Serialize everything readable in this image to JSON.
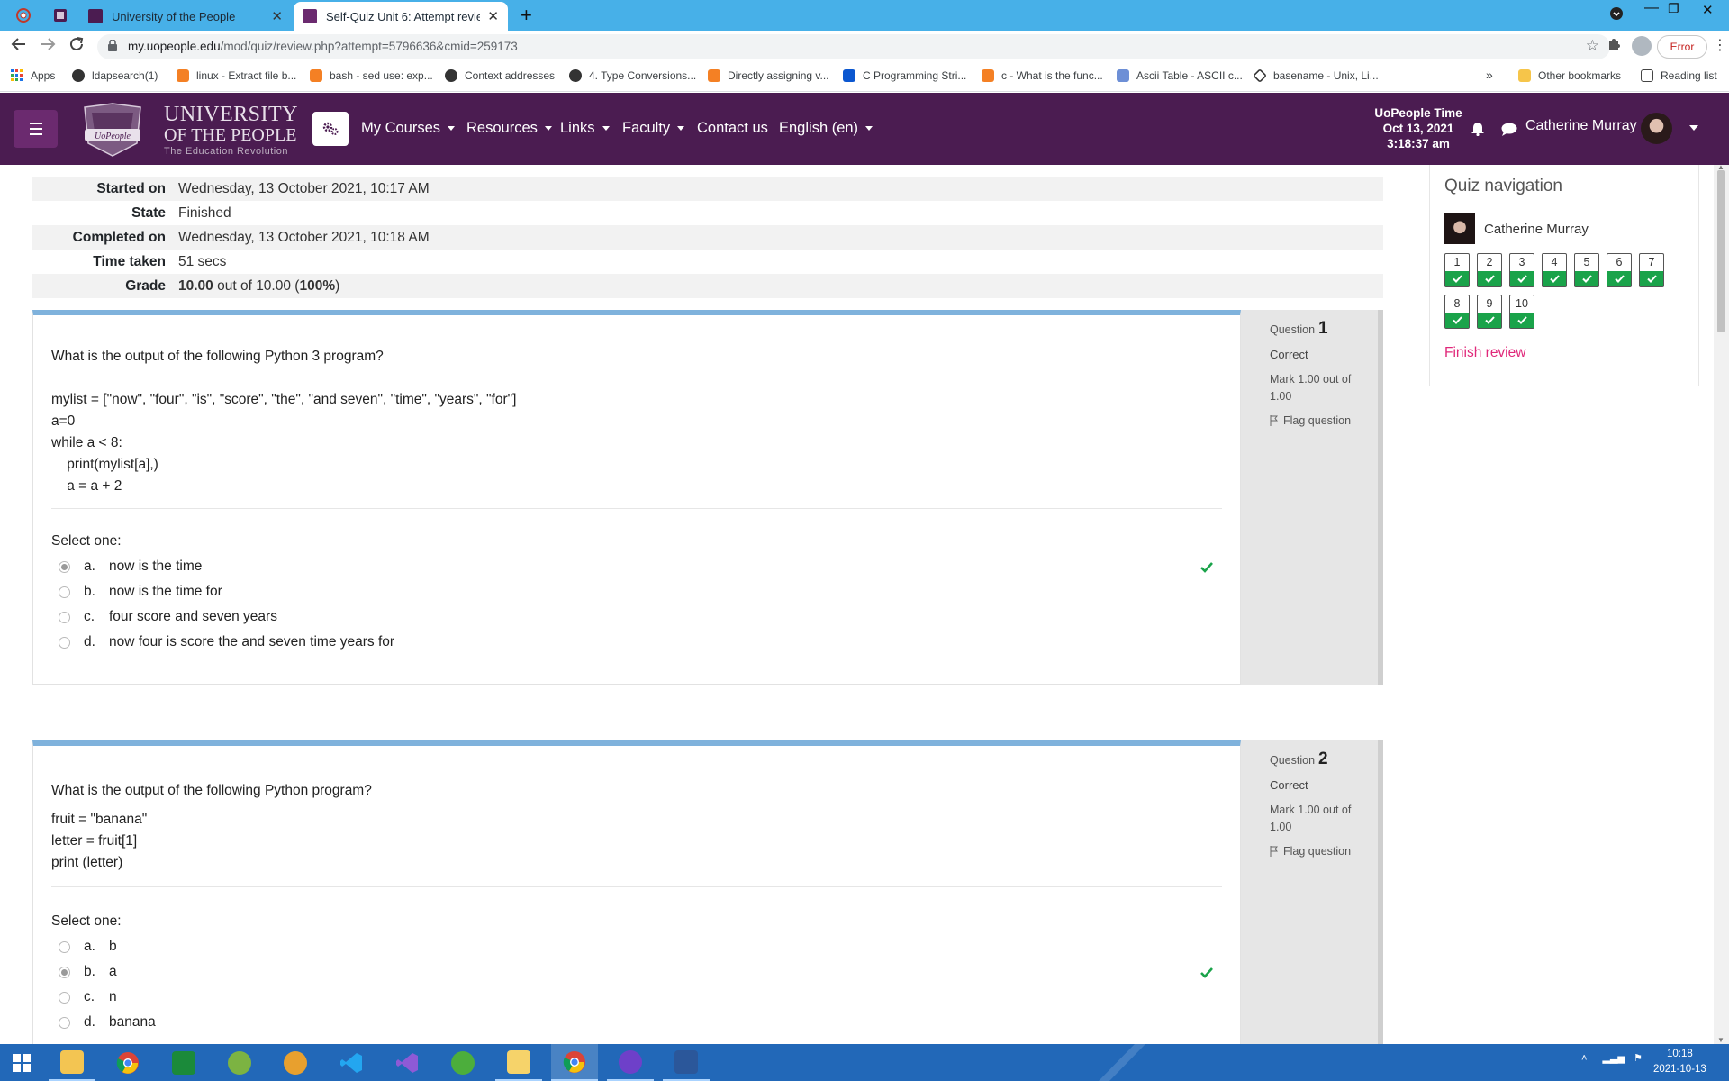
{
  "browser": {
    "tabs": [
      {
        "title": "University of the People",
        "active": false
      },
      {
        "title": "Self-Quiz Unit 6: Attempt review",
        "active": true
      }
    ],
    "url_host": "my.uopeople.edu",
    "url_path": "/mod/quiz/review.php?attempt=5796636&cmid=259173",
    "error_label": "Error",
    "bookmarks": [
      "Apps",
      "ldapsearch(1)",
      "linux - Extract file b...",
      "bash - sed use: exp...",
      "Context addresses",
      "4. Type Conversions...",
      "Directly assigning v...",
      "C Programming Stri...",
      "c - What is the func...",
      "Ascii Table - ASCII c...",
      "basename - Unix, Li...",
      "»",
      "Other bookmarks",
      "Reading list"
    ]
  },
  "site": {
    "logo_line1": "UNIVERSITY",
    "logo_line2": "OF THE PEOPLE",
    "logo_tagline": "The Education Revolution",
    "crest_text": "UoPeople",
    "nav": [
      "My Courses",
      "Resources",
      "Links",
      "Faculty",
      "Contact us",
      "English (en)"
    ],
    "time_label": "UoPeople Time",
    "time_date": "Oct 13, 2021",
    "time_clock": "3:18:37 am",
    "user_name": "Catherine Murray"
  },
  "summary": [
    {
      "label": "Started on",
      "value": "Wednesday, 13 October 2021, 10:17 AM"
    },
    {
      "label": "State",
      "value": "Finished"
    },
    {
      "label": "Completed on",
      "value": "Wednesday, 13 October 2021, 10:18 AM"
    },
    {
      "label": "Time taken",
      "value": "51 secs"
    }
  ],
  "grade": {
    "label": "Grade",
    "score": "10.00",
    "mid": " out of 10.00 (",
    "pct": "100%",
    "end": ")"
  },
  "questions": [
    {
      "label": "Question",
      "number": "1",
      "state": "Correct",
      "mark": "Mark 1.00 out of 1.00",
      "flag": "Flag question",
      "prompt": "What is the output of the following Python 3 program?",
      "code": "mylist = [\"now\", \"four\", \"is\", \"score\", \"the\", \"and seven\", \"time\", \"years\", \"for\"]\na=0\nwhile a < 8:\n    print(mylist[a],)\n    a = a + 2",
      "select": "Select one:",
      "options": [
        {
          "letter": "a.",
          "text": "now is the time",
          "selected": true
        },
        {
          "letter": "b.",
          "text": "now is the time for",
          "selected": false
        },
        {
          "letter": "c.",
          "text": "four score and seven years",
          "selected": false
        },
        {
          "letter": "d.",
          "text": "now four is score the and seven time years for",
          "selected": false
        }
      ]
    },
    {
      "label": "Question",
      "number": "2",
      "state": "Correct",
      "mark": "Mark 1.00 out of 1.00",
      "flag": "Flag question",
      "prompt": "What is the output of the following Python program?",
      "code": "fruit = \"banana\"\nletter = fruit[1]\nprint (letter)",
      "select": "Select one:",
      "options": [
        {
          "letter": "a.",
          "text": "b",
          "selected": false
        },
        {
          "letter": "b.",
          "text": "a",
          "selected": true
        },
        {
          "letter": "c.",
          "text": "n",
          "selected": false
        },
        {
          "letter": "d.",
          "text": "banana",
          "selected": false
        }
      ]
    }
  ],
  "quiz_nav": {
    "title": "Quiz navigation",
    "user": "Catherine Murray",
    "buttons": [
      "1",
      "2",
      "3",
      "4",
      "5",
      "6",
      "7",
      "8",
      "9",
      "10"
    ],
    "finish": "Finish review"
  },
  "taskbar": {
    "clock_time": "10:18",
    "clock_date": "2021-10-13"
  },
  "colors": {
    "header": "#4b1c51",
    "question_top_border": "#7fb2dc",
    "nav_correct": "#1aa34a",
    "finish_link": "#e0287a",
    "tabstrip": "#47b0e8",
    "taskbar": "#2268b8"
  }
}
